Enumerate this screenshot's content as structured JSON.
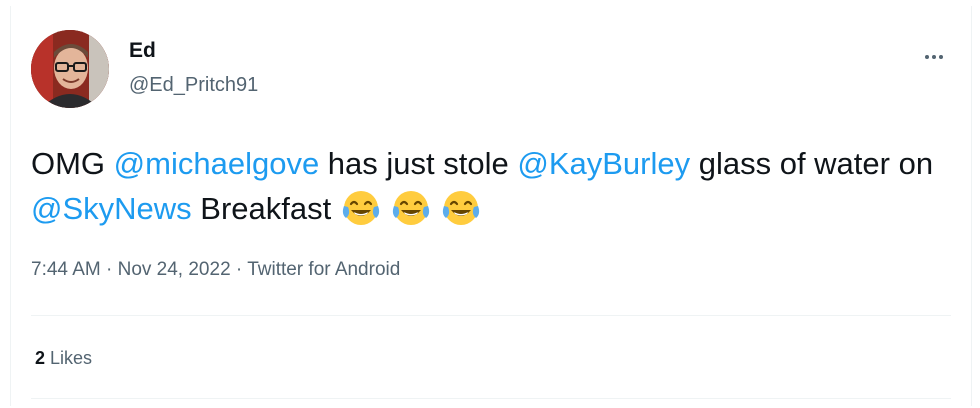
{
  "tweet": {
    "author": {
      "display_name": "Ed",
      "handle": "@Ed_Pritch91"
    },
    "more_icon": "more-horizontal-icon",
    "text": {
      "w1": "OMG ",
      "m1": "@michaelgove",
      "w2": " has just stole ",
      "m2": "@KayBurley",
      "w3": " glass of water on ",
      "m3": "@SkyNews",
      "w4": " Breakfast ",
      "emojis": [
        "face-with-tears-of-joy-icon",
        "face-with-tears-of-joy-icon",
        "face-with-tears-of-joy-icon"
      ]
    },
    "meta": {
      "time": "7:44 AM",
      "sep1": " · ",
      "date": "Nov 24, 2022",
      "sep2": " · ",
      "source": "Twitter for Android"
    },
    "likes": {
      "count": "2",
      "label": " Likes"
    },
    "colors": {
      "link": "#1d9bf0",
      "text": "#0f1419",
      "secondary": "#536471",
      "divider": "#eff3f4"
    }
  }
}
